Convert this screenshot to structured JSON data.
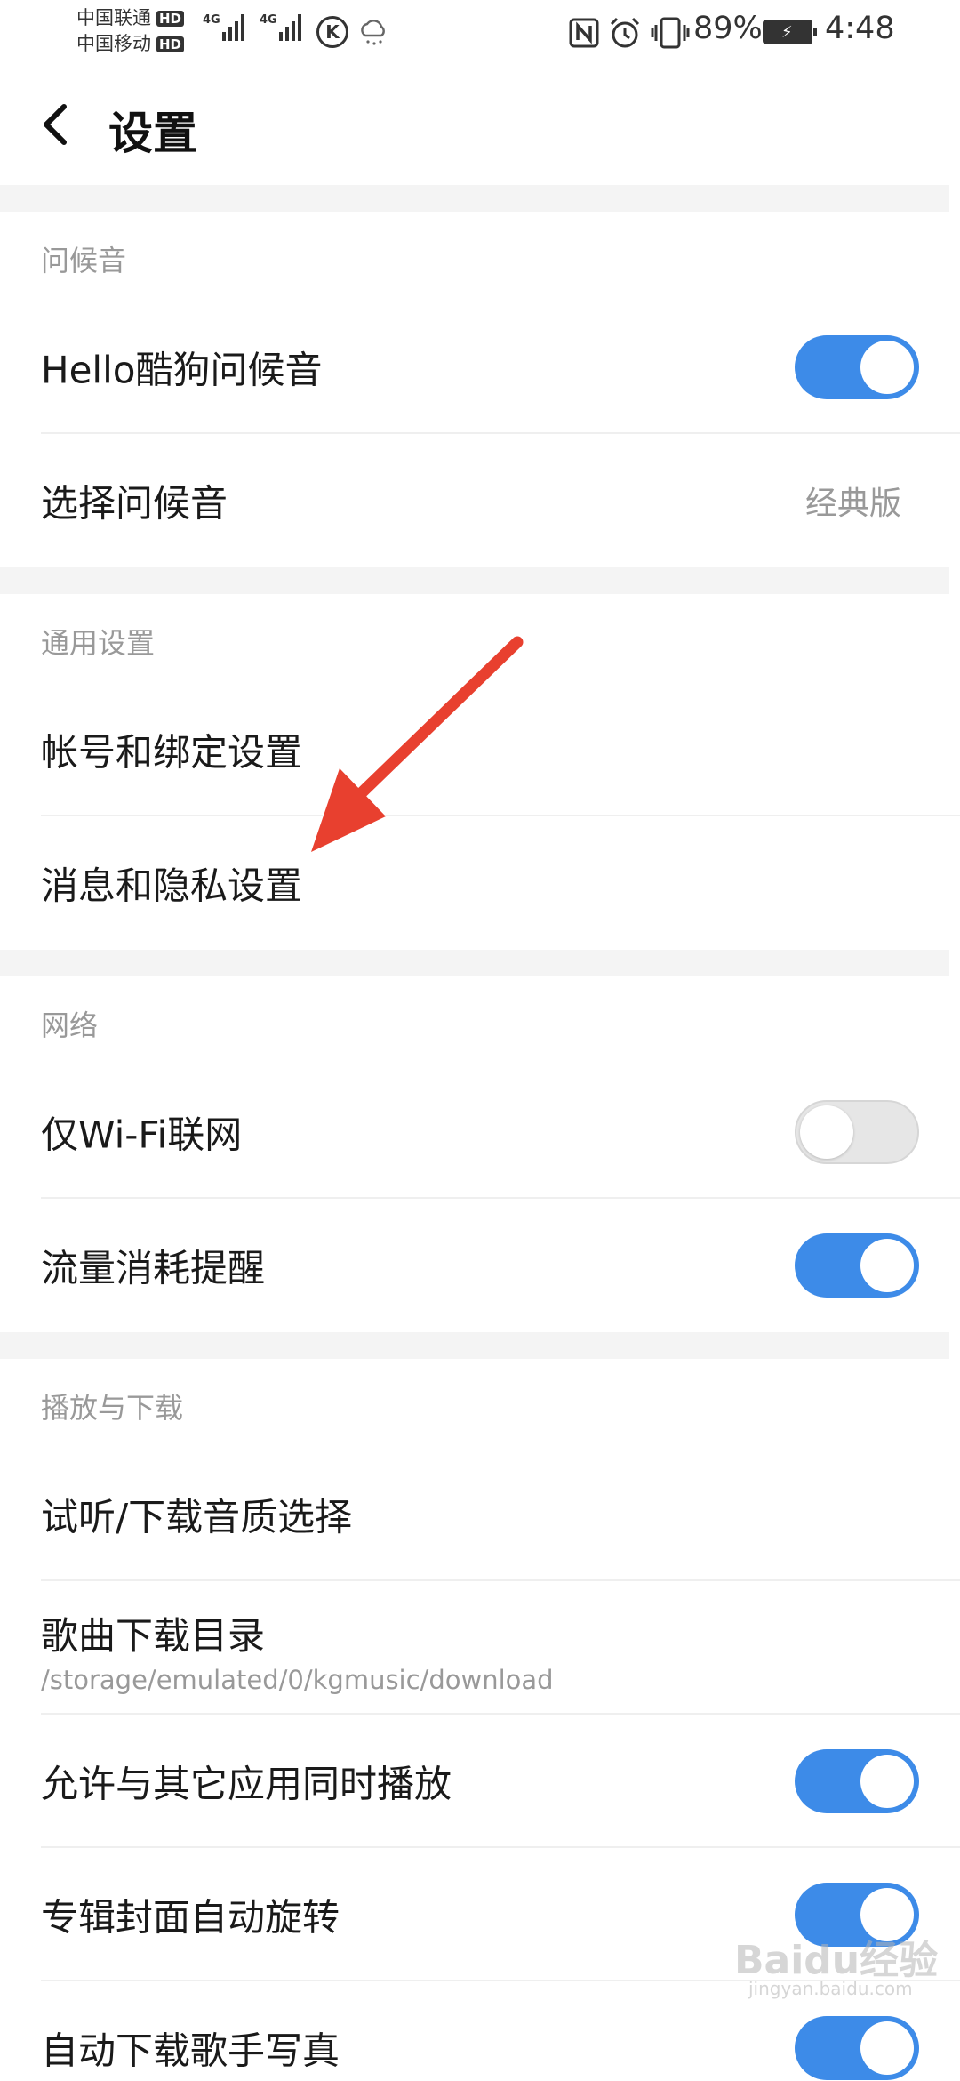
{
  "status_bar": {
    "carrier_1": "中国联通",
    "carrier_2": "中国移动",
    "hd_label": "HD",
    "net_type": "4G",
    "battery_percent": "89%",
    "time": "4:48",
    "icons": [
      "signal-icon",
      "k-app-icon",
      "cloud-rain-icon",
      "nfc-icon",
      "alarm-icon",
      "vibrate-icon",
      "battery-charging-icon"
    ]
  },
  "header": {
    "back_icon": "chevron-left-icon",
    "title": "设置"
  },
  "sections": {
    "greeting": {
      "header": "问候音",
      "hello_label": "Hello酷狗问候音",
      "hello_on": true,
      "choose_label": "选择问候音",
      "choose_value": "经典版"
    },
    "general": {
      "header": "通用设置",
      "account_label": "帐号和绑定设置",
      "privacy_label": "消息和隐私设置"
    },
    "network": {
      "header": "网络",
      "wifi_only_label": "仅Wi-Fi联网",
      "wifi_only_on": false,
      "traffic_label": "流量消耗提醒",
      "traffic_on": true
    },
    "playback": {
      "header": "播放与下载",
      "quality_label": "试听/下载音质选择",
      "download_dir_label": "歌曲下载目录",
      "download_dir_path": "/storage/emulated/0/kgmusic/download",
      "mix_play_label": "允许与其它应用同时播放",
      "mix_play_on": true,
      "rotate_cover_label": "专辑封面自动旋转",
      "rotate_cover_on": true,
      "auto_photo_label": "自动下载歌手写真",
      "auto_photo_on": true
    }
  },
  "annotation": {
    "arrow_color": "#e8402f"
  },
  "watermark": {
    "brand": "Baidu经验",
    "url": "jingyan.baidu.com"
  },
  "colors": {
    "accent": "#3d8be8",
    "section_gap": "#f4f4f4",
    "secondary_text": "#999999"
  }
}
